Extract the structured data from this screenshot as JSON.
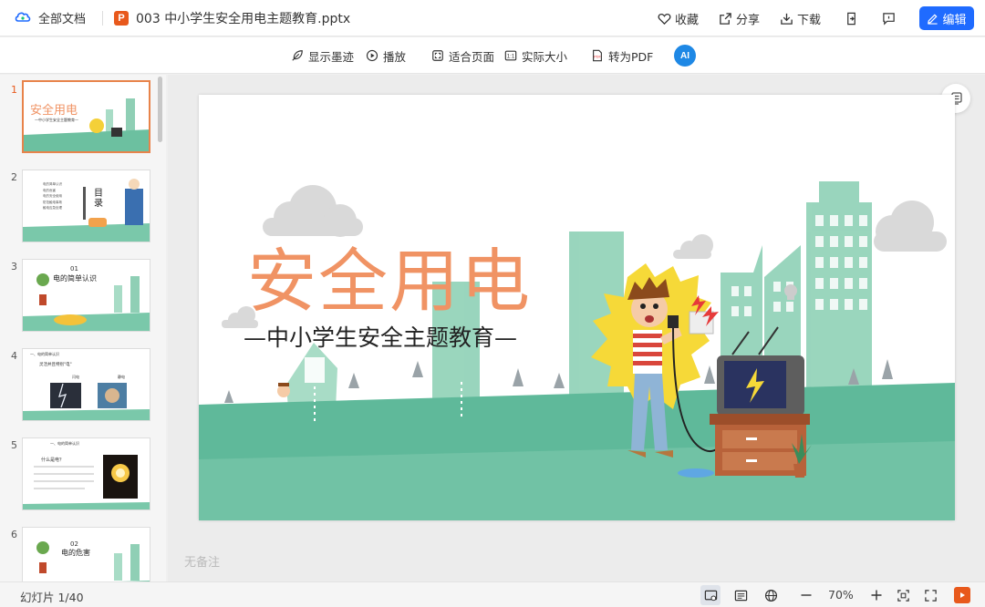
{
  "topbar": {
    "all_docs_label": "全部文档",
    "file_icon_letter": "P",
    "filename": "003 中小学生安全用电主题教育.pptx",
    "actions": {
      "favorite": "收藏",
      "share": "分享",
      "download": "下载"
    },
    "edit_label": "编辑"
  },
  "toolbar": {
    "show_ink": "显示墨迹",
    "play": "播放",
    "fit_page": "适合页面",
    "actual_size": "实际大小",
    "to_pdf": "转为PDF",
    "ai_label": "AI"
  },
  "thumbnails": [
    {
      "number": "1",
      "title": "安全用电",
      "subtitle": "—中小学生安全主题教育—"
    },
    {
      "number": "2",
      "title": "目\n录",
      "items": [
        "电的简单认识",
        "电的危害",
        "电的安全使用",
        "防范触电事故",
        "触电应急处理"
      ]
    },
    {
      "number": "3",
      "label": "01",
      "title": "电的简单认识"
    },
    {
      "number": "4",
      "header": "一、电的简单认识",
      "title": "灵活并且特别\"电\"",
      "captions": [
        "闪电",
        "静电"
      ]
    },
    {
      "number": "5",
      "header": "一、电的简单认识",
      "title": "什么是电？"
    },
    {
      "number": "6",
      "label": "02",
      "title": "电的危害"
    }
  ],
  "slide": {
    "title": "安全用电",
    "subtitle": "—中小学生安全主题教育—"
  },
  "notes_placeholder": "无备注",
  "statusbar": {
    "slide_count": "幻灯片 1/40",
    "zoom": "70%"
  },
  "colors": {
    "accent": "#1f6bff",
    "title_orange": "#f09364",
    "ppt_orange": "#e8591c",
    "ground_green": "#5fb99a"
  }
}
